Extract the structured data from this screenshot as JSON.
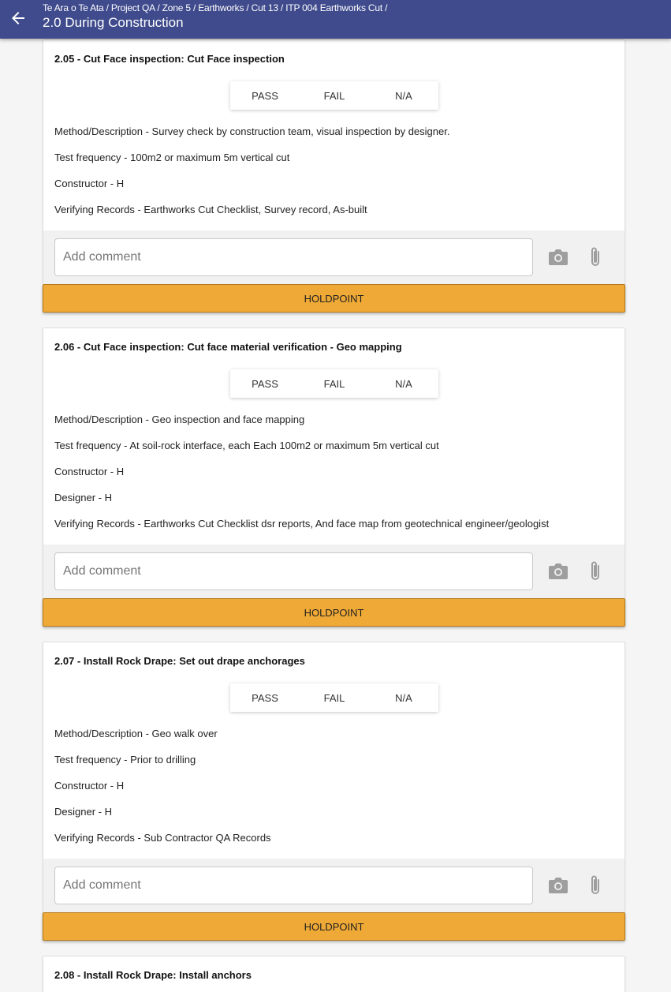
{
  "header": {
    "breadcrumb": "Te Ara o Te Ata / Project QA / Zone 5 / Earthworks / Cut 13 / ITP 004 Earthworks Cut /",
    "title": "2.0 During Construction"
  },
  "icons": {
    "back": "arrow-left-icon",
    "camera": "camera-icon",
    "attach": "paperclip-icon"
  },
  "colors": {
    "appbar": "#3f4b8c",
    "holdpoint": "#efa936"
  },
  "options": {
    "pass": "PASS",
    "fail": "FAIL",
    "na": "N/A"
  },
  "comment_placeholder": "Add comment",
  "holdpoint_label": "HOLDPOINT",
  "items": [
    {
      "title": "2.05 - Cut Face inspection: Cut Face inspection",
      "lines": [
        "Method/Description - Survey check by construction team, visual inspection by designer.",
        "Test frequency - 100m2 or maximum 5m vertical cut",
        "Constructor - H",
        "Verifying Records - Earthworks Cut Checklist, Survey record, As-built"
      ]
    },
    {
      "title": "2.06 - Cut Face inspection: Cut face material verification - Geo mapping",
      "lines": [
        "Method/Description - Geo inspection and face mapping",
        "Test frequency - At soil-rock interface, each Each 100m2 or maximum 5m vertical cut",
        "Constructor - H",
        "Designer - H",
        "Verifying Records - Earthworks Cut Checklist dsr reports, And face map from geotechnical engineer/geologist"
      ]
    },
    {
      "title": "2.07 - Install Rock Drape: Set out drape anchorages",
      "lines": [
        "Method/Description - Geo walk over",
        "Test frequency - Prior to drilling",
        "Constructor - H",
        "Designer - H",
        "Verifying Records - Sub Contractor QA Records"
      ]
    },
    {
      "title": "2.08 - Install Rock Drape: Install anchors"
    }
  ]
}
